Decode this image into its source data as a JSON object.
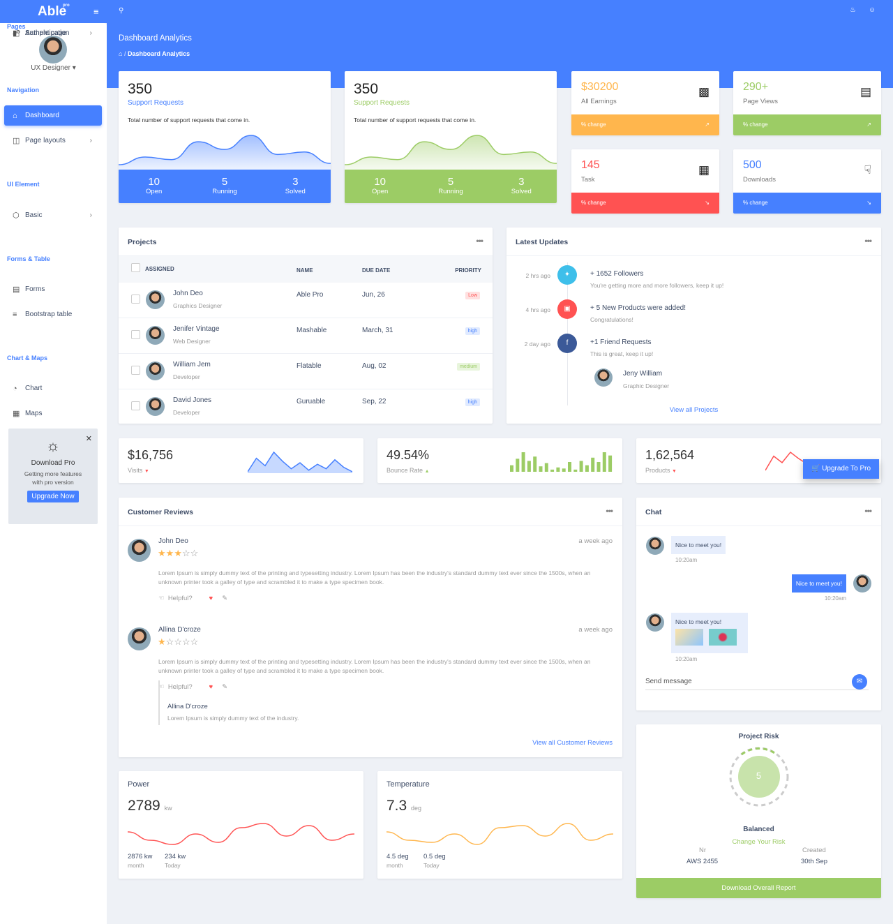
{
  "brand": {
    "name": "Able",
    "sup": "pro"
  },
  "colors": {
    "primary": "#4680ff",
    "success": "#9ccc65",
    "warning": "#ffb64d",
    "danger": "#ff5252",
    "info": "#3ebfea",
    "facebook": "#3b5998"
  },
  "header": {
    "title": "Dashboard Analytics",
    "breadcrumb": "Dashboard Analytics"
  },
  "sidebar": {
    "user": "UX Designer",
    "sections": [
      {
        "caption": "Navigation",
        "items": [
          {
            "label": "Dashboard",
            "icon": "home-icon",
            "active": true
          },
          {
            "label": "Page layouts",
            "icon": "layout-icon",
            "chevron": true
          }
        ]
      },
      {
        "caption": "UI Element",
        "items": [
          {
            "label": "Basic",
            "icon": "box-icon",
            "chevron": true
          }
        ]
      },
      {
        "caption": "Forms & Table",
        "items": [
          {
            "label": "Forms",
            "icon": "file-icon"
          },
          {
            "label": "Bootstrap table",
            "icon": "list-icon"
          }
        ]
      },
      {
        "caption": "Chart & Maps",
        "items": [
          {
            "label": "Chart",
            "icon": "pie-chart-icon"
          },
          {
            "label": "Maps",
            "icon": "map-icon"
          }
        ]
      },
      {
        "caption": "Pages",
        "items": [
          {
            "label": "Authentication",
            "icon": "lock-icon",
            "chevron": true
          },
          {
            "label": "Sample page",
            "icon": "sidebar-icon"
          }
        ]
      }
    ],
    "promo": {
      "title": "Download Pro",
      "text1": "Getting more features",
      "text2": "with pro version",
      "button": "Upgrade Now"
    }
  },
  "support": [
    {
      "value": "350",
      "label": "Support Requests",
      "desc": "Total number of support requests that come in.",
      "stats": [
        {
          "v": "10",
          "l": "Open"
        },
        {
          "v": "5",
          "l": "Running"
        },
        {
          "v": "3",
          "l": "Solved"
        }
      ],
      "series": [
        2,
        8,
        6,
        20,
        14,
        25,
        10,
        12,
        3
      ]
    },
    {
      "value": "350",
      "label": "Support Requests",
      "desc": "Total number of support requests that come in.",
      "stats": [
        {
          "v": "10",
          "l": "Open"
        },
        {
          "v": "5",
          "l": "Running"
        },
        {
          "v": "3",
          "l": "Solved"
        }
      ],
      "series": [
        2,
        8,
        6,
        20,
        14,
        25,
        10,
        12,
        3
      ]
    }
  ],
  "stats": [
    {
      "value": "$30200",
      "label": "All Earnings",
      "footer": "% change",
      "trend": "up"
    },
    {
      "value": "290+",
      "label": "Page Views",
      "footer": "% change",
      "trend": "up"
    },
    {
      "value": "145",
      "label": "Task",
      "footer": "% change",
      "trend": "down"
    },
    {
      "value": "500",
      "label": "Downloads",
      "footer": "% change",
      "trend": "down"
    }
  ],
  "projects": {
    "title": "Projects",
    "headers": [
      "ASSIGNED",
      "NAME",
      "DUE DATE",
      "PRIORITY"
    ],
    "rows": [
      {
        "name": "John Deo",
        "role": "Graphics Designer",
        "project": "Able Pro",
        "due": "Jun, 26",
        "priority": "Low"
      },
      {
        "name": "Jenifer Vintage",
        "role": "Web Designer",
        "project": "Mashable",
        "due": "March, 31",
        "priority": "high"
      },
      {
        "name": "William Jem",
        "role": "Developer",
        "project": "Flatable",
        "due": "Aug, 02",
        "priority": "medium"
      },
      {
        "name": "David Jones",
        "role": "Developer",
        "project": "Guruable",
        "due": "Sep, 22",
        "priority": "high"
      }
    ]
  },
  "updates": {
    "title": "Latest Updates",
    "items": [
      {
        "time": "2 hrs ago",
        "title": "+ 1652 Followers",
        "text": "You're getting more and more followers, keep it up!",
        "icon": "twitter-icon"
      },
      {
        "time": "4 hrs ago",
        "title": "+ 5 New Products were added!",
        "text": "Congratulations!",
        "icon": "briefcase-icon"
      },
      {
        "time": "2 day ago",
        "title": "+1 Friend Requests",
        "text": "This is great, keep it up!",
        "icon": "facebook-icon"
      }
    ],
    "person": {
      "name": "Jeny William",
      "role": "Graphic Designer"
    },
    "link": "View all Projects"
  },
  "mini": [
    {
      "value": "$16,756",
      "label": "Visits",
      "trend": "down",
      "series": [
        5,
        14,
        9,
        18,
        12,
        7,
        11,
        6,
        10,
        7,
        13,
        8,
        5
      ]
    },
    {
      "value": "49.54%",
      "label": "Bounce Rate",
      "trend": "up",
      "series": [
        6,
        12,
        18,
        10,
        14,
        5,
        8,
        2,
        4,
        3,
        9,
        2,
        10,
        6,
        13,
        9,
        18,
        15
      ]
    },
    {
      "value": "1,62,564",
      "label": "Products",
      "trend": "down",
      "series": [
        3,
        14,
        9,
        17,
        12,
        8
      ],
      "button": "Upgrade To Pro"
    }
  ],
  "reviews": {
    "title": "Customer Reviews",
    "items": [
      {
        "name": "John Deo",
        "time": "a week ago",
        "rating": 3,
        "text": "Lorem Ipsum is simply dummy text of the printing and typesetting industry. Lorem Ipsum has been the industry's standard dummy text ever since the 1500s, when an unknown printer took a galley of type and scrambled it to make a type specimen book.",
        "helpful": "Helpful?"
      },
      {
        "name": "Allina D'croze",
        "time": "a week ago",
        "rating": 1,
        "text": "Lorem Ipsum is simply dummy text of the printing and typesetting industry. Lorem Ipsum has been the industry's standard dummy text ever since the 1500s, when an unknown printer took a galley of type and scrambled it to make a type specimen book.",
        "helpful": "Helpful?",
        "reply": {
          "name": "Allina D'croze",
          "text": "Lorem Ipsum is simply dummy text of the industry."
        }
      }
    ],
    "link": "View all Customer Reviews"
  },
  "chat": {
    "title": "Chat",
    "messages": [
      {
        "text": "Nice to meet you!",
        "time": "10:20am",
        "side": "left"
      },
      {
        "text": "Nice to meet you!",
        "time": "10:20am",
        "side": "right"
      },
      {
        "text": "Nice to meet you!",
        "time": "10:20am",
        "side": "left"
      }
    ],
    "placeholder": "Send message"
  },
  "risk": {
    "title": "Project Risk",
    "value": "5",
    "status": "Balanced",
    "link": "Change Your Risk",
    "nr_label": "Nr",
    "nr": "AWS 2455",
    "created_label": "Created",
    "created": "30th Sep",
    "button": "Download Overall Report"
  },
  "power": {
    "title": "Power",
    "value": "2789",
    "unit": "kw",
    "a": "2876 kw",
    "a_label": "month",
    "b": "234 kw",
    "b_label": "Today",
    "series": [
      10,
      6,
      4,
      9,
      5,
      12,
      14,
      8,
      13,
      6,
      9
    ]
  },
  "temperature": {
    "title": "Temperature",
    "value": "7.3",
    "unit": "deg",
    "a": "4.5 deg",
    "a_label": "month",
    "b": "0.5 deg",
    "b_label": "Today",
    "series": [
      10,
      6,
      5,
      9,
      4,
      12,
      13,
      8,
      14,
      6,
      9
    ]
  }
}
